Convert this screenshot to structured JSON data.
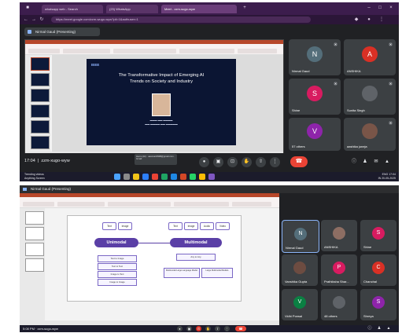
{
  "screenshot1": {
    "browser": {
      "tabs": [
        {
          "label": "whatsapp web - Search",
          "active": false
        },
        {
          "label": "(23) WhatsApp",
          "active": false
        },
        {
          "label": "Meet - zzm-sugo-wyw",
          "active": true
        }
      ],
      "url": "https://meet.google.com/zzm-wugo-wyw?pli=1&authuser=1"
    },
    "presenting_label": "Nirmal Gaud (Presenting)",
    "slide": {
      "logo": "IEEE",
      "title_line1": "The Transformative Impact of Emerging AI",
      "title_line2": "Trends on Society and Industry"
    },
    "participants": [
      {
        "initial": "N",
        "name": "Nirmal Gaud",
        "color": "#546e7a"
      },
      {
        "initial": "A",
        "name": "ANSHIKA",
        "color": "#d93025"
      },
      {
        "initial": "S",
        "name": "Shine",
        "color": "#d81b60"
      },
      {
        "initial": "",
        "name": "Sunita Singh",
        "color": "#5f6368"
      },
      {
        "initial": "V",
        "name": "57 others",
        "color": "#8e24aa"
      },
      {
        "initial": "",
        "name": "aashika juneja",
        "color": "#795548"
      }
    ],
    "meeting": {
      "time": "17:04",
      "code": "zzm-xugo-wyw",
      "tooltip": "Hemo (Hi) · aasmani0998@gmail.com · Gmail"
    },
    "taskbar": {
      "weather_line1": "Trending videos",
      "weather_line2": "Anything Screen",
      "tray_lang_1": "ENG",
      "tray_lang_2": "IN",
      "tray_time": "17:04",
      "tray_date": "20-05-2025"
    },
    "icons": [
      "back-icon",
      "forward-icon",
      "refresh-icon",
      "mic-icon",
      "camera-icon",
      "captions-icon",
      "raise-hand-icon",
      "present-icon",
      "more-icon",
      "end-call-icon",
      "info-icon",
      "people-icon",
      "chat-icon",
      "activities-icon"
    ]
  },
  "screenshot2": {
    "presenting_label": "Nirmal Gaud (Presenting)",
    "diagram": {
      "left_inputs": [
        "Text",
        "Image"
      ],
      "right_inputs": [
        "Text",
        "Image",
        "Audio",
        "Video"
      ],
      "left_title": "Unimodal",
      "right_title": "Multimodal",
      "left_boxes": [
        "Text to Image",
        "Text to Text",
        "Image to Text",
        "Image to Image"
      ],
      "right_top_box": "Any to Any",
      "right_bottom_left": "Multimodal Large Language Model",
      "right_bottom_right": "Large Multimodal Models"
    },
    "participants": [
      {
        "initial": "N",
        "name": "Nirmal Gaud",
        "color": "#546e7a"
      },
      {
        "initial": "",
        "name": "ANSHIKA",
        "color": "#8d6e63"
      },
      {
        "initial": "S",
        "name": "Shine",
        "color": "#d81b60"
      },
      {
        "initial": "",
        "name": "Vanshika Gupta",
        "color": "#6d4c41"
      },
      {
        "initial": "P",
        "name": "Prathiksha Shar...",
        "color": "#d81b60"
      },
      {
        "initial": "C",
        "name": "Chanchal",
        "color": "#d93025"
      },
      {
        "initial": "V",
        "name": "Vidhi Porwal",
        "color": "#0b8043"
      },
      {
        "initial": "",
        "name": "48 others",
        "color": "#5f6368"
      },
      {
        "initial": "S",
        "name": "Shreya",
        "color": "#8e24aa"
      }
    ],
    "time_code": "5:08 PM · zzm-sugo-wyw"
  }
}
